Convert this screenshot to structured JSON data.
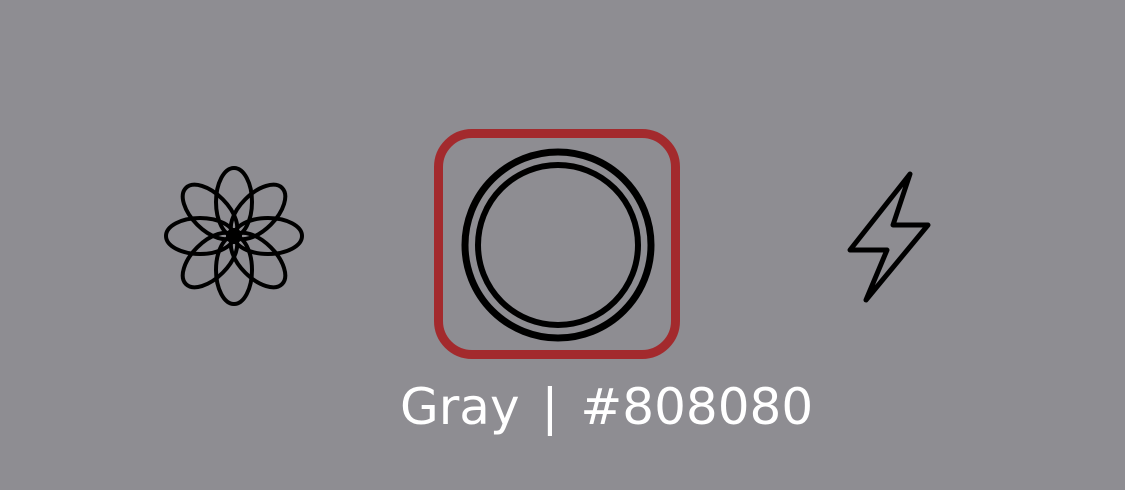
{
  "camera_controls": {
    "flower_icon": "flower-icon",
    "shutter_icon": "shutter-circle-icon",
    "flash_icon": "lightning-icon",
    "selected_color_name": "Gray",
    "separator": "|",
    "selected_color_hex": "#808080"
  },
  "colors": {
    "background": "#8e8d92",
    "highlight": "#a32a2d",
    "icon": "#000000",
    "text": "#ffffff"
  }
}
